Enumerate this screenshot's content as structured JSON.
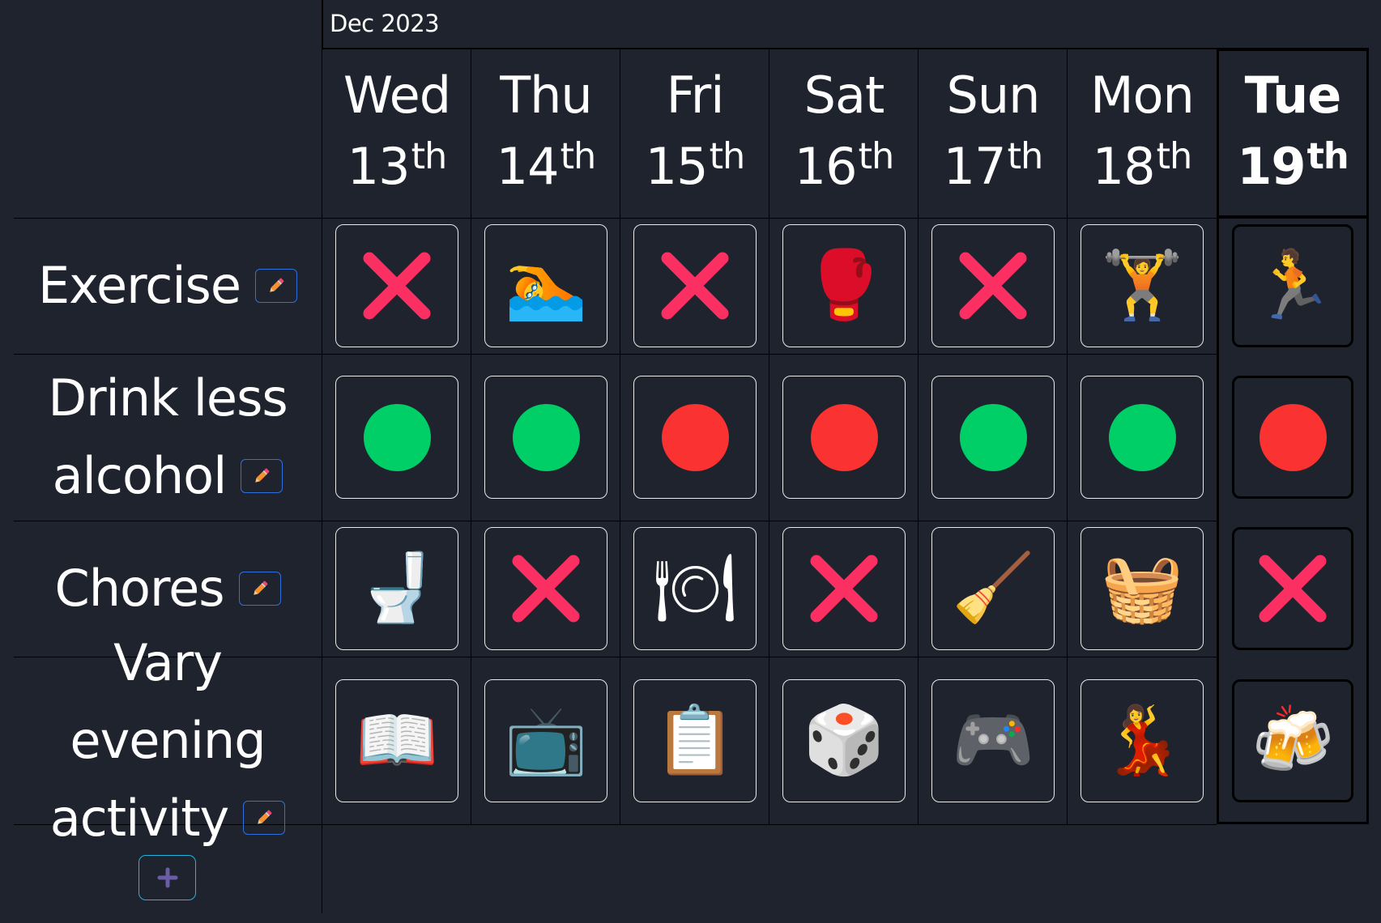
{
  "header": {
    "month_label": "Dec 2023"
  },
  "colors": {
    "background": "#1f232e",
    "success": "#00cf68",
    "failure": "#fa3232",
    "cross": "#fc2f63",
    "edit_border": "#2f6fdc",
    "add_border": "#21b3dc",
    "add_icon": "#6a5ca6"
  },
  "days": [
    {
      "weekday": "Wed",
      "date": "13",
      "suffix": "th",
      "today": false
    },
    {
      "weekday": "Thu",
      "date": "14",
      "suffix": "th",
      "today": false
    },
    {
      "weekday": "Fri",
      "date": "15",
      "suffix": "th",
      "today": false
    },
    {
      "weekday": "Sat",
      "date": "16",
      "suffix": "th",
      "today": false
    },
    {
      "weekday": "Sun",
      "date": "17",
      "suffix": "th",
      "today": false
    },
    {
      "weekday": "Mon",
      "date": "18",
      "suffix": "th",
      "today": false
    },
    {
      "weekday": "Tue",
      "date": "19",
      "suffix": "th",
      "today": true
    }
  ],
  "habits": [
    {
      "name": "Exercise",
      "lines": [
        "Exercise"
      ],
      "edit_icon": "pencil-icon",
      "entries": [
        {
          "type": "cross",
          "icon": "cross-mark-icon"
        },
        {
          "type": "emoji",
          "icon": "person-swimming-icon",
          "glyph": "🏊"
        },
        {
          "type": "cross",
          "icon": "cross-mark-icon"
        },
        {
          "type": "emoji",
          "icon": "boxing-glove-icon",
          "glyph": "🥊"
        },
        {
          "type": "cross",
          "icon": "cross-mark-icon"
        },
        {
          "type": "emoji",
          "icon": "person-lifting-weights-icon",
          "glyph": "🏋"
        },
        {
          "type": "emoji",
          "icon": "person-running-icon",
          "glyph": "🏃"
        }
      ]
    },
    {
      "name": "Drink less alcohol",
      "lines": [
        "Drink less",
        "alcohol"
      ],
      "edit_icon": "pencil-icon",
      "entries": [
        {
          "type": "success",
          "icon": "green-circle-icon"
        },
        {
          "type": "success",
          "icon": "green-circle-icon"
        },
        {
          "type": "failure",
          "icon": "red-circle-icon"
        },
        {
          "type": "failure",
          "icon": "red-circle-icon"
        },
        {
          "type": "success",
          "icon": "green-circle-icon"
        },
        {
          "type": "success",
          "icon": "green-circle-icon"
        },
        {
          "type": "failure",
          "icon": "red-circle-icon"
        }
      ]
    },
    {
      "name": "Chores",
      "lines": [
        "Chores"
      ],
      "edit_icon": "pencil-icon",
      "entries": [
        {
          "type": "emoji",
          "icon": "toilet-icon",
          "glyph": "🚽"
        },
        {
          "type": "cross",
          "icon": "cross-mark-icon"
        },
        {
          "type": "emoji",
          "icon": "fork-knife-plate-icon",
          "glyph": "🍽"
        },
        {
          "type": "cross",
          "icon": "cross-mark-icon"
        },
        {
          "type": "emoji",
          "icon": "broom-icon",
          "glyph": "🧹"
        },
        {
          "type": "emoji",
          "icon": "basket-icon",
          "glyph": "🧺"
        },
        {
          "type": "cross",
          "icon": "cross-mark-icon"
        }
      ]
    },
    {
      "name": "Vary evening activity",
      "lines": [
        "Vary evening",
        "activity"
      ],
      "edit_icon": "pencil-icon",
      "entries": [
        {
          "type": "emoji",
          "icon": "open-book-icon",
          "glyph": "📖"
        },
        {
          "type": "emoji",
          "icon": "television-icon",
          "glyph": "📺"
        },
        {
          "type": "emoji",
          "icon": "clipboard-icon",
          "glyph": "📋"
        },
        {
          "type": "emoji",
          "icon": "game-die-icon",
          "glyph": "🎲"
        },
        {
          "type": "emoji",
          "icon": "video-game-icon",
          "glyph": "🎮"
        },
        {
          "type": "emoji",
          "icon": "woman-dancing-icon",
          "glyph": "💃"
        },
        {
          "type": "emoji",
          "icon": "clinking-beer-mugs-icon",
          "glyph": "🍻"
        }
      ]
    }
  ],
  "add_habit": {
    "icon": "plus-icon"
  }
}
